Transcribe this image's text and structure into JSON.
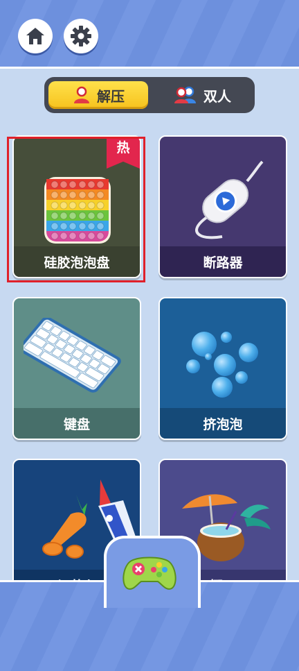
{
  "toggle": {
    "active_label": "解压",
    "inactive_label": "双人"
  },
  "cards": [
    {
      "label": "硅胶泡泡盘",
      "hot_badge": "热",
      "selected": true
    },
    {
      "label": "断路器"
    },
    {
      "label": "键盘"
    },
    {
      "label": "挤泡泡"
    },
    {
      "label": "切萝卜"
    },
    {
      "label": "椰子"
    }
  ],
  "colors": {
    "selection_border": "#e0202a",
    "toggle_active": "#f8cf2c",
    "hot_badge": "#e2264d"
  }
}
